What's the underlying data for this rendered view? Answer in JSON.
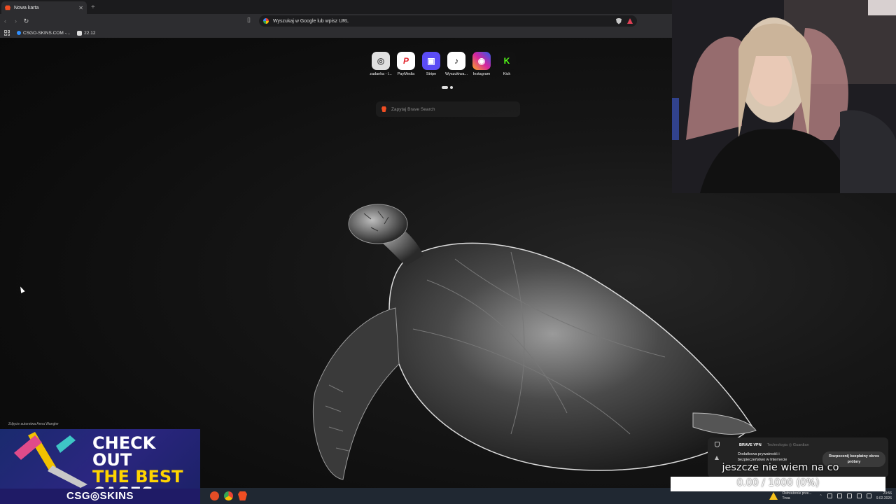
{
  "browser": {
    "tab": {
      "title": "Nowa karta",
      "close": "✕"
    },
    "new_tab_symbol": "+",
    "address": {
      "placeholder": "Wyszukaj w Google lub wpisz URL"
    },
    "bookmarks": [
      {
        "label": "CSGO-SKINS.COM -..."
      },
      {
        "label": "22.12"
      }
    ]
  },
  "new_tab_page": {
    "top_sites": [
      {
        "label": "zadanka - l...",
        "icon": "safari-like-icon",
        "color": "#e0e0e0",
        "glyph": "◎",
        "glyph_color": "#555"
      },
      {
        "label": "PayMedia",
        "icon": "paymedia-icon",
        "color": "#ffffff",
        "glyph": "P",
        "glyph_color": "#e3262f"
      },
      {
        "label": "Stripe",
        "icon": "stripe-icon",
        "color": "#ffffff",
        "glyph": "▣",
        "glyph_color": "#5b4cf5"
      },
      {
        "label": "Wyszukiwa...",
        "icon": "tiktok-icon",
        "color": "#ffffff",
        "glyph": "♪",
        "glyph_color": "#111"
      },
      {
        "label": "Instagram",
        "icon": "instagram-icon",
        "color": "#ffffff",
        "glyph": "◉",
        "glyph_color": "#d6249f"
      },
      {
        "label": "Kick",
        "icon": "kick-icon",
        "color": "#ffffff",
        "glyph": "K",
        "glyph_color": "#53fc18"
      }
    ],
    "search_placeholder": "Zapytaj Brave Search",
    "photo_credit": "Zdjęcie autorstwa Anna Wangler"
  },
  "ad": {
    "line1": "CHECK OUT",
    "line2": "THE BEST",
    "line3": "CASES",
    "brand": "CSG◎SKINS"
  },
  "vpn_popup": {
    "title": "BRAVE VPN",
    "subtitle": "Technologia ◎ Guardian",
    "description": "Dodatkowa prywatność i bezpieczeństwo w Internecie",
    "button": "Rozpocznij bezpłatny okres próbny"
  },
  "donation": {
    "message": "jeszcze nie wiem na co",
    "progress_text": "0.00 / 1000 (0%)",
    "progress_fraction": 0.0,
    "color": "#6a5acd"
  },
  "taskbar": {
    "notification": "Ostrzeżenie prze... Trwa",
    "time": "23:56",
    "date": "9.02.2026"
  }
}
